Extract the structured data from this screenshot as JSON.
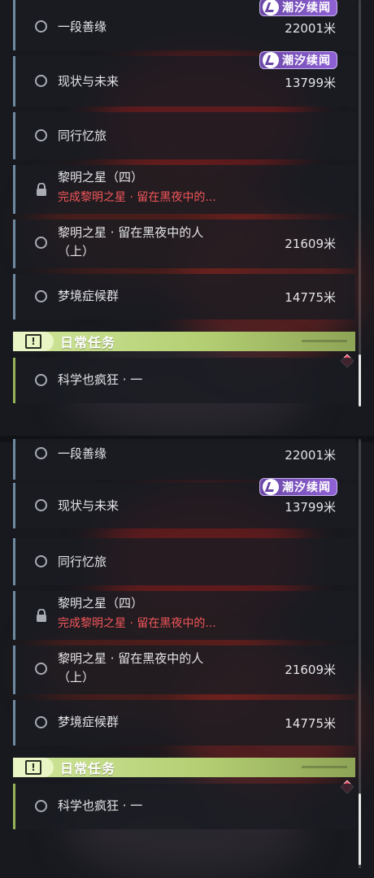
{
  "tasks": [
    {
      "title": "一段善缘",
      "distance": "22001米",
      "badge": "潮汐续闻",
      "state": "circle"
    },
    {
      "title": "现状与未来",
      "distance": "13799米",
      "badge": "潮汐续闻",
      "state": "circle"
    },
    {
      "title": "同行忆旅",
      "distance": "",
      "state": "circle"
    },
    {
      "title": "黎明之星（四）",
      "subtitle": "完成黎明之星 · 留在黑夜中的...",
      "distance": "",
      "state": "locked"
    },
    {
      "title_line1": "黎明之星 · 留在黑夜中的人",
      "title_line2": "（上）",
      "distance": "21609米",
      "state": "circle"
    },
    {
      "title": "梦境症候群",
      "distance": "14775米",
      "state": "circle"
    }
  ],
  "daily": {
    "header": "日常任务",
    "header_icon": "exclamation-icon",
    "tasks": [
      {
        "title": "科学也疯狂 · 一",
        "state": "circle"
      }
    ]
  },
  "colors": {
    "accent_blue": "#6f8aa0",
    "accent_green": "#97b35a",
    "warning_red": "#f2565a",
    "badge_purple": "#8f62d4"
  }
}
